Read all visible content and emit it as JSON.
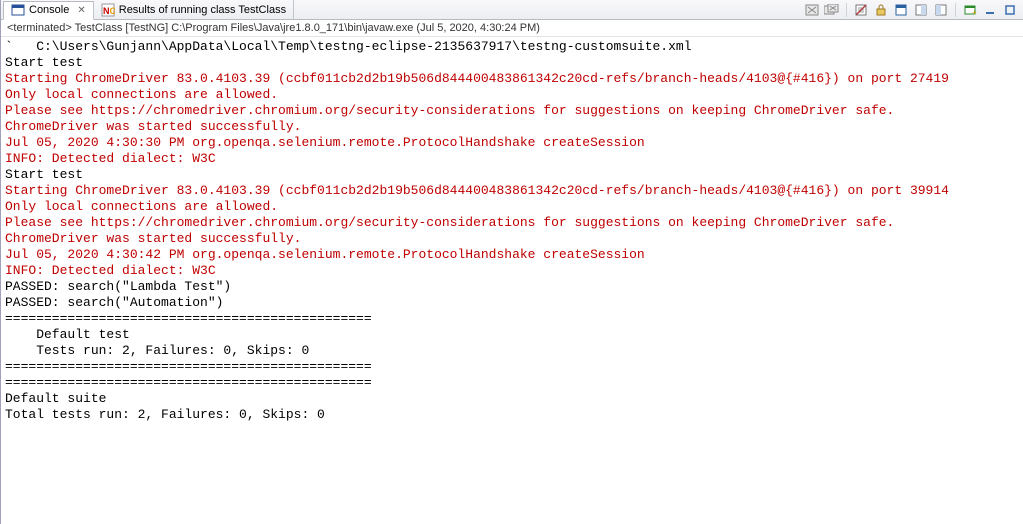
{
  "tabs": {
    "console": {
      "label": "Console"
    },
    "results": {
      "label": "Results of running class TestClass"
    }
  },
  "runinfo": "<terminated> TestClass [TestNG] C:\\Program Files\\Java\\jre1.8.0_171\\bin\\javaw.exe (Jul 5, 2020, 4:30:24 PM)",
  "console_lines": [
    {
      "cls": "",
      "text": "`   C:\\Users\\Gunjann\\AppData\\Local\\Temp\\testng-eclipse-2135637917\\testng-customsuite.xml"
    },
    {
      "cls": "",
      "text": ""
    },
    {
      "cls": "",
      "text": "Start test"
    },
    {
      "cls": "err",
      "text": "Starting ChromeDriver 83.0.4103.39 (ccbf011cb2d2b19b506d844400483861342c20cd-refs/branch-heads/4103@{#416}) on port 27419"
    },
    {
      "cls": "err",
      "text": "Only local connections are allowed."
    },
    {
      "cls": "err",
      "text": "Please see https://chromedriver.chromium.org/security-considerations for suggestions on keeping ChromeDriver safe."
    },
    {
      "cls": "err",
      "text": "ChromeDriver was started successfully."
    },
    {
      "cls": "err",
      "text": "Jul 05, 2020 4:30:30 PM org.openqa.selenium.remote.ProtocolHandshake createSession"
    },
    {
      "cls": "err",
      "text": "INFO: Detected dialect: W3C"
    },
    {
      "cls": "",
      "text": "Start test"
    },
    {
      "cls": "err",
      "text": "Starting ChromeDriver 83.0.4103.39 (ccbf011cb2d2b19b506d844400483861342c20cd-refs/branch-heads/4103@{#416}) on port 39914"
    },
    {
      "cls": "err",
      "text": "Only local connections are allowed."
    },
    {
      "cls": "err",
      "text": "Please see https://chromedriver.chromium.org/security-considerations for suggestions on keeping ChromeDriver safe."
    },
    {
      "cls": "err",
      "text": "ChromeDriver was started successfully."
    },
    {
      "cls": "err",
      "text": "Jul 05, 2020 4:30:42 PM org.openqa.selenium.remote.ProtocolHandshake createSession"
    },
    {
      "cls": "err",
      "text": "INFO: Detected dialect: W3C"
    },
    {
      "cls": "",
      "text": "PASSED: search(\"Lambda Test\")"
    },
    {
      "cls": "",
      "text": "PASSED: search(\"Automation\")"
    },
    {
      "cls": "",
      "text": ""
    },
    {
      "cls": "",
      "text": "==============================================="
    },
    {
      "cls": "",
      "text": "    Default test"
    },
    {
      "cls": "",
      "text": "    Tests run: 2, Failures: 0, Skips: 0"
    },
    {
      "cls": "",
      "text": "==============================================="
    },
    {
      "cls": "",
      "text": ""
    },
    {
      "cls": "",
      "text": ""
    },
    {
      "cls": "",
      "text": "==============================================="
    },
    {
      "cls": "",
      "text": "Default suite"
    },
    {
      "cls": "",
      "text": "Total tests run: 2, Failures: 0, Skips: 0"
    }
  ]
}
